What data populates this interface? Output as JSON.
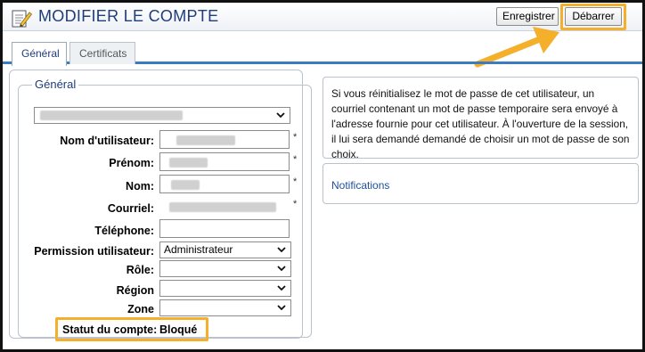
{
  "header": {
    "title": "MODIFIER LE COMPTE",
    "save_label": "Enregistrer",
    "unlock_label": "Débarrer"
  },
  "tabs": [
    {
      "label": "Général",
      "active": true
    },
    {
      "label": "Certificats",
      "active": false
    }
  ],
  "form": {
    "legend": "Général",
    "fields": {
      "username_label": "Nom d'utilisateur:",
      "firstname_label": "Prénom:",
      "lastname_label": "Nom:",
      "email_label": "Courriel:",
      "phone_label": "Téléphone:",
      "permission_label": "Permission utilisateur:",
      "permission_value": "Administrateur",
      "role_label": "Rôle:",
      "region_label": "Région",
      "zone_label": "Zone",
      "required_mark": "*"
    },
    "status_label": "Statut du compte:",
    "status_value": "Bloqué"
  },
  "info": {
    "text": "Si vous réinitialisez le mot de passe de cet utilisateur, un courriel contenant un mot de passe temporaire sera envoyé à l'adresse fournie pour cet utilisateur. À l'ouverture de la session, il lui sera demandé demandé de choisir un mot de passe de son choix.",
    "notifications_label": "Notifications"
  },
  "colors": {
    "accent_blue": "#3b7bbf",
    "title_blue": "#1f3d7a",
    "highlight_orange": "#f4b02a"
  }
}
